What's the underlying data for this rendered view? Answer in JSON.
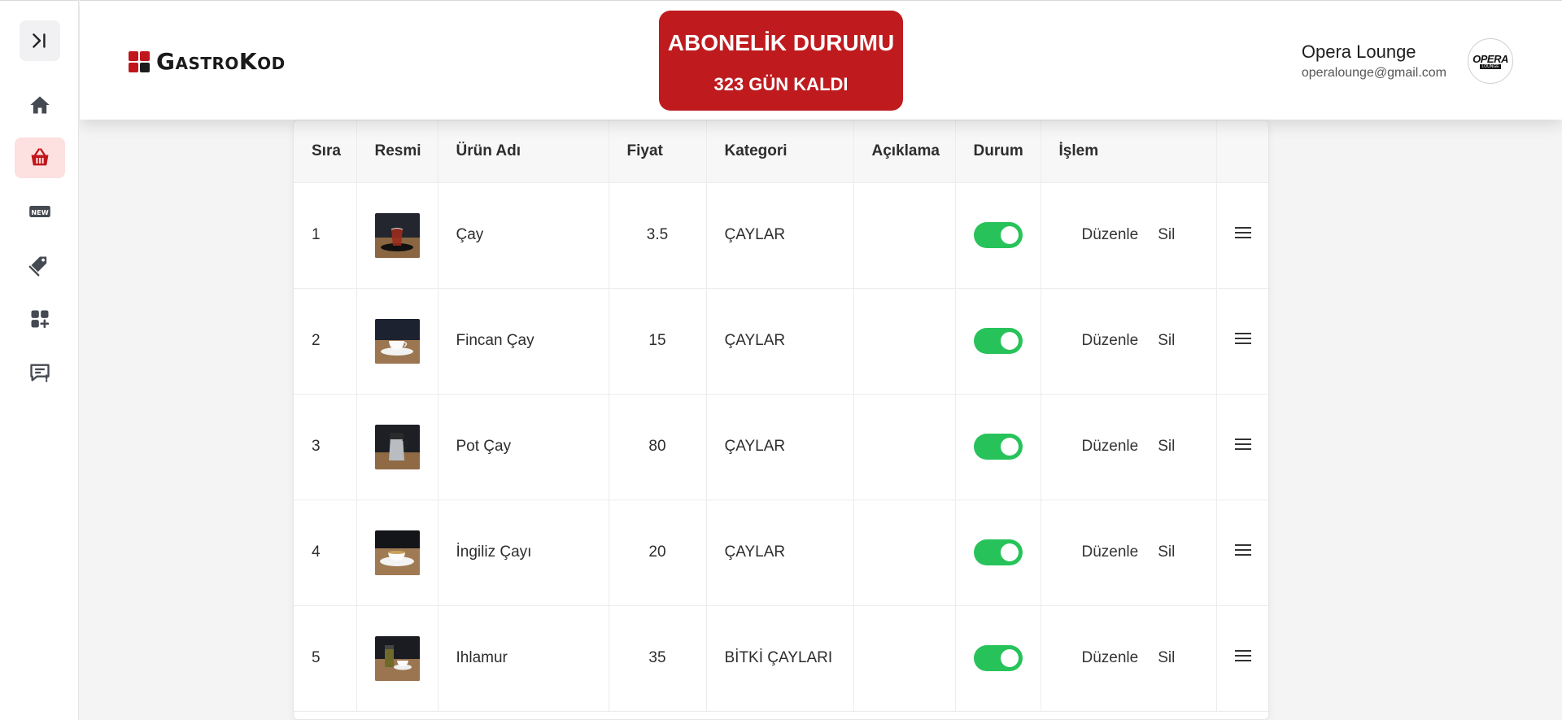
{
  "brand": {
    "logo_text": "GastroKod",
    "accent": "#c0161c"
  },
  "subscription": {
    "title": "ABONELİK DURUMU",
    "days_left": "323 GÜN KALDI",
    "color": "#bf1b1f"
  },
  "user": {
    "name": "Opera Lounge",
    "email": "operalounge@gmail.com",
    "avatar_text": "OPERA",
    "avatar_sub": "LOUNGE"
  },
  "sidebar": {
    "items": [
      {
        "icon": "home-icon",
        "active": false
      },
      {
        "icon": "basket-icon",
        "active": true
      },
      {
        "icon": "new-badge-icon",
        "active": false
      },
      {
        "icon": "tags-icon",
        "active": false
      },
      {
        "icon": "add-category-icon",
        "active": false
      },
      {
        "icon": "feedback-icon",
        "active": false
      }
    ]
  },
  "table": {
    "headers": [
      "Sıra",
      "Resmi",
      "Ürün Adı",
      "Fiyat",
      "Kategori",
      "Açıklama",
      "Durum",
      "İşlem",
      ""
    ],
    "edit_label": "Düzenle",
    "delete_label": "Sil",
    "rows": [
      {
        "order": "1",
        "name": "Çay",
        "price": "3.5",
        "category": "ÇAYLAR",
        "description": "",
        "status": true
      },
      {
        "order": "2",
        "name": "Fincan Çay",
        "price": "15",
        "category": "ÇAYLAR",
        "description": "",
        "status": true
      },
      {
        "order": "3",
        "name": "Pot Çay",
        "price": "80",
        "category": "ÇAYLAR",
        "description": "",
        "status": true
      },
      {
        "order": "4",
        "name": "İngiliz Çayı",
        "price": "20",
        "category": "ÇAYLAR",
        "description": "",
        "status": true
      },
      {
        "order": "5",
        "name": "Ihlamur",
        "price": "35",
        "category": "BİTKİ ÇAYLARI",
        "description": "",
        "status": true
      }
    ]
  },
  "colors": {
    "toggle_on": "#27c35a",
    "active_nav_bg": "#fde0e0"
  }
}
